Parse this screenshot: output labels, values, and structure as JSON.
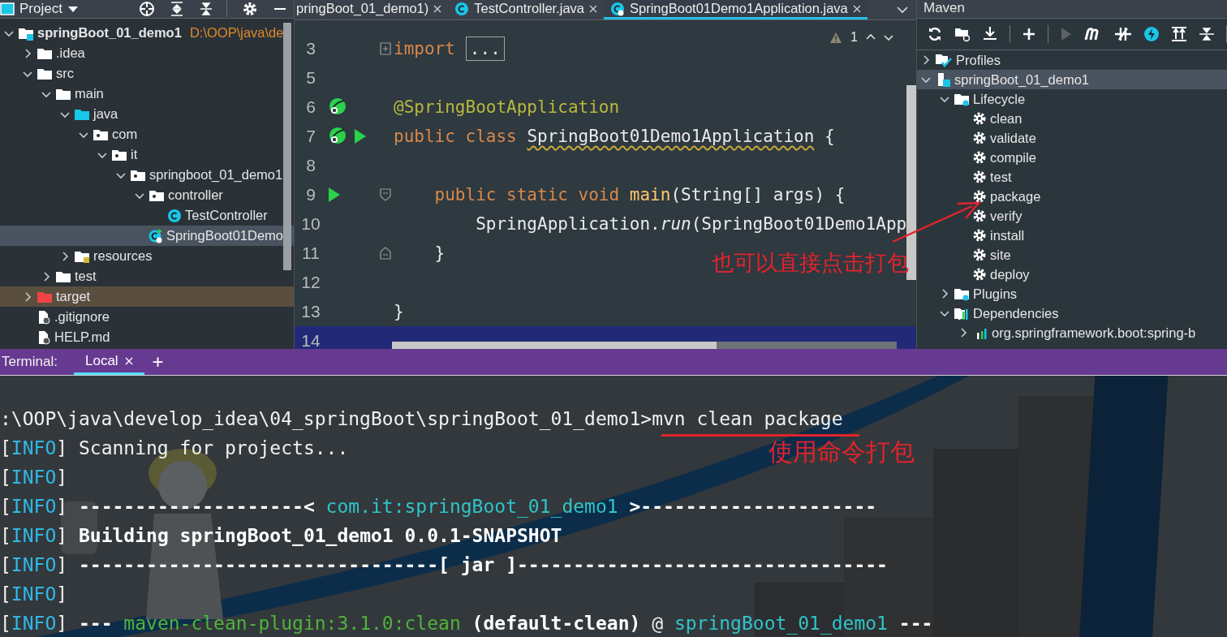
{
  "project_panel": {
    "title": "Project",
    "tree": [
      {
        "label": "springBoot_01_demo1",
        "path": "D:\\OOP\\java\\de",
        "kind": "module",
        "expanded": true,
        "selected": false,
        "children": [
          {
            "label": ".idea",
            "kind": "folder",
            "expanded": false,
            "selected": false
          },
          {
            "label": "src",
            "kind": "folder",
            "expanded": true,
            "selected": false,
            "children": [
              {
                "label": "main",
                "kind": "folder",
                "expanded": true,
                "selected": false,
                "children": [
                  {
                    "label": "java",
                    "kind": "source_folder",
                    "expanded": true,
                    "selected": false,
                    "children": [
                      {
                        "label": "com",
                        "kind": "package",
                        "expanded": true,
                        "selected": false,
                        "children": [
                          {
                            "label": "it",
                            "kind": "package",
                            "expanded": true,
                            "selected": false,
                            "children": [
                              {
                                "label": "springboot_01_demo1",
                                "kind": "package",
                                "expanded": true,
                                "selected": false,
                                "children": [
                                  {
                                    "label": "controller",
                                    "kind": "package",
                                    "expanded": true,
                                    "selected": false,
                                    "children": [
                                      {
                                        "label": "TestController",
                                        "kind": "class",
                                        "selected": false
                                      }
                                    ]
                                  },
                                  {
                                    "label": "SpringBoot01Demo",
                                    "kind": "spring_class",
                                    "selected": true
                                  }
                                ]
                              }
                            ]
                          }
                        ]
                      }
                    ]
                  },
                  {
                    "label": "resources",
                    "kind": "resource_folder",
                    "expanded": false,
                    "selected": false
                  }
                ]
              },
              {
                "label": "test",
                "kind": "folder",
                "expanded": false,
                "selected": false
              }
            ]
          },
          {
            "label": "target",
            "kind": "excluded_folder",
            "expanded": false,
            "selected": false
          },
          {
            "label": ".gitignore",
            "kind": "file",
            "selected": false
          },
          {
            "label": "HELP.md",
            "kind": "file",
            "selected": false
          }
        ]
      }
    ]
  },
  "editor": {
    "tabs": [
      {
        "label": "pringBoot_01_demo1)",
        "kind": "plain",
        "selected": false
      },
      {
        "label": "TestController.java",
        "kind": "class",
        "selected": false
      },
      {
        "label": "SpringBoot01Demo1Application.java",
        "kind": "spring_class",
        "selected": true
      }
    ],
    "warnings": "1",
    "lines": [
      {
        "number": "3",
        "fold": {
          "kind": "collapsed"
        },
        "current": false,
        "tokens": [
          {
            "text": "import",
            "kind": "keyword"
          },
          {
            "text": "...",
            "kind": "folded"
          }
        ]
      },
      {
        "number": "5",
        "current": false
      },
      {
        "number": "6",
        "gutter_icons": [
          {
            "kind": "bean"
          }
        ],
        "current": false,
        "tokens": [
          {
            "text": "@SpringBootApplication",
            "kind": "annotation"
          }
        ]
      },
      {
        "number": "7",
        "gutter_icons": [
          {
            "kind": "bean"
          },
          {
            "kind": "run"
          }
        ],
        "current": false,
        "tokens": [
          {
            "text": "public class ",
            "kind": "keyword"
          },
          {
            "text": "SpringBoot01Demo1Application",
            "kind": "warning"
          },
          {
            "text": " {",
            "kind": "plain"
          }
        ]
      },
      {
        "number": "8",
        "current": false
      },
      {
        "number": "9",
        "gutter_icons": [
          {
            "kind": "run"
          }
        ],
        "fold": {
          "kind": "start"
        },
        "current": false,
        "tokens": [
          {
            "text": "    public static void ",
            "kind": "keyword"
          },
          {
            "text": "main",
            "kind": "method"
          },
          {
            "text": "(String[] args) {",
            "kind": "plain"
          }
        ]
      },
      {
        "number": "10",
        "current": false,
        "tokens": [
          {
            "text": "        SpringApplication.",
            "kind": "plain"
          },
          {
            "text": "run",
            "kind": "italic"
          },
          {
            "text": "(SpringBoot01Demo1App",
            "kind": "plain"
          }
        ]
      },
      {
        "number": "11",
        "fold": {
          "kind": "end"
        },
        "current": false,
        "tokens": [
          {
            "text": "    }",
            "kind": "plain"
          }
        ]
      },
      {
        "number": "12",
        "current": false
      },
      {
        "number": "13",
        "current": false,
        "tokens": [
          {
            "text": "}",
            "kind": "plain"
          }
        ]
      },
      {
        "number": "14",
        "current": true
      }
    ]
  },
  "maven_panel": {
    "title": "Maven",
    "tree": [
      {
        "label": "Profiles",
        "kind": "profiles",
        "expanded": false,
        "selected": false
      },
      {
        "label": "springBoot_01_demo1",
        "kind": "maven_module",
        "expanded": true,
        "selected": true,
        "children": [
          {
            "label": "Lifecycle",
            "kind": "lifecycle",
            "expanded": true,
            "selected": false,
            "children": [
              {
                "label": "clean",
                "kind": "goal",
                "selected": false
              },
              {
                "label": "validate",
                "kind": "goal",
                "selected": false
              },
              {
                "label": "compile",
                "kind": "goal",
                "selected": false
              },
              {
                "label": "test",
                "kind": "goal",
                "selected": false
              },
              {
                "label": "package",
                "kind": "goal",
                "selected": false
              },
              {
                "label": "verify",
                "kind": "goal",
                "selected": false
              },
              {
                "label": "install",
                "kind": "goal",
                "selected": false
              },
              {
                "label": "site",
                "kind": "goal",
                "selected": false
              },
              {
                "label": "deploy",
                "kind": "goal",
                "selected": false
              }
            ]
          },
          {
            "label": "Plugins",
            "kind": "lifecycle",
            "expanded": false,
            "selected": false
          },
          {
            "label": "Dependencies",
            "kind": "dependencies",
            "expanded": true,
            "selected": false,
            "children": [
              {
                "label": "org.springframework.boot:spring-b",
                "kind": "dependency",
                "expanded": false,
                "selected": false
              }
            ]
          }
        ]
      }
    ]
  },
  "terminal": {
    "title": "Terminal:",
    "tabs": [
      {
        "label": "Local",
        "selected": true
      }
    ],
    "new_tab": "+",
    "lines": [
      [
        {
          "text": ":\\OOP\\java\\develop_idea\\04_springBoot\\springBoot_01_demo1>mvn clean package",
          "kind": "plain"
        }
      ],
      [
        {
          "text": "[",
          "kind": "plain"
        },
        {
          "text": "INFO",
          "kind": "info"
        },
        {
          "text": "] Scanning for projects...",
          "kind": "plain"
        }
      ],
      [
        {
          "text": "[",
          "kind": "plain"
        },
        {
          "text": "INFO",
          "kind": "info"
        },
        {
          "text": "]",
          "kind": "plain"
        }
      ],
      [
        {
          "text": "[",
          "kind": "plain"
        },
        {
          "text": "INFO",
          "kind": "info"
        },
        {
          "text": "] ",
          "kind": "plain"
        },
        {
          "text": "--------------------< ",
          "kind": "bold"
        },
        {
          "text": "com.it:springBoot_01_demo1",
          "kind": "cyan"
        },
        {
          "text": " >---------------------",
          "kind": "bold"
        }
      ],
      [
        {
          "text": "[",
          "kind": "plain"
        },
        {
          "text": "INFO",
          "kind": "info"
        },
        {
          "text": "] ",
          "kind": "plain"
        },
        {
          "text": "Building springBoot_01_demo1 0.0.1-SNAPSHOT",
          "kind": "bold"
        }
      ],
      [
        {
          "text": "[",
          "kind": "plain"
        },
        {
          "text": "INFO",
          "kind": "info"
        },
        {
          "text": "] ",
          "kind": "plain"
        },
        {
          "text": "--------------------------------[ jar ]---------------------------------",
          "kind": "bold"
        }
      ],
      [
        {
          "text": "[",
          "kind": "plain"
        },
        {
          "text": "INFO",
          "kind": "info"
        },
        {
          "text": "]",
          "kind": "plain"
        }
      ],
      [
        {
          "text": "[",
          "kind": "plain"
        },
        {
          "text": "INFO",
          "kind": "info"
        },
        {
          "text": "] ",
          "kind": "plain"
        },
        {
          "text": "--- ",
          "kind": "bold"
        },
        {
          "text": "maven-clean-plugin:3.1.0:clean",
          "kind": "green"
        },
        {
          "text": " (default-clean)",
          "kind": "bold"
        },
        {
          "text": " @ ",
          "kind": "plain"
        },
        {
          "text": "springBoot_01_demo1",
          "kind": "cyan"
        },
        {
          "text": " ---",
          "kind": "bold"
        }
      ]
    ]
  },
  "annotations": [
    {
      "text": "也可以直接点击打包",
      "kind": "arrow_note"
    },
    {
      "text": "使用命令打包",
      "kind": "underline_note"
    }
  ]
}
